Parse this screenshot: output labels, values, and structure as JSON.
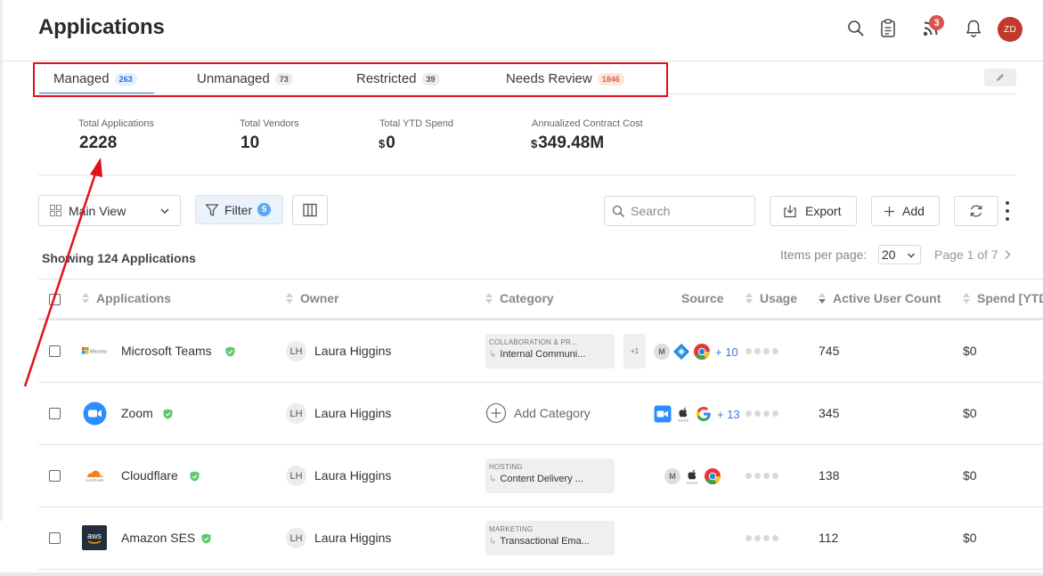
{
  "header": {
    "title": "Applications",
    "notifications_badge": "3",
    "avatar_initials": "ZD",
    "icons": [
      "search-icon",
      "clipboard-icon",
      "feed-icon",
      "bell-icon"
    ]
  },
  "tabs": [
    {
      "label": "Managed",
      "count": "263",
      "active": true
    },
    {
      "label": "Unmanaged",
      "count": "73"
    },
    {
      "label": "Restricted",
      "count": "39"
    },
    {
      "label": "Needs Review",
      "count": "1846"
    }
  ],
  "stats": [
    {
      "label": "Total Applications",
      "value": "2228",
      "currency": ""
    },
    {
      "label": "Total Vendors",
      "value": "10",
      "currency": ""
    },
    {
      "label": "Total YTD Spend",
      "value": "0",
      "currency": "$"
    },
    {
      "label": "Annualized Contract Cost",
      "value": "349.48M",
      "currency": "$"
    }
  ],
  "toolbar": {
    "view_label": "Main View",
    "filter_label": "Filter",
    "filter_count": "5",
    "search_placeholder": "Search",
    "export_label": "Export",
    "add_label": "Add"
  },
  "list_info": {
    "showing": "Showing 124 Applications",
    "items_per_page_label": "Items per page:",
    "items_per_page": "20",
    "page_info": "Page 1 of 7"
  },
  "columns": [
    "Applications",
    "Owner",
    "Category",
    "Source",
    "Usage",
    "Active User Count",
    "Spend [YTD]"
  ],
  "rows": [
    {
      "name": "Microsoft Teams",
      "logo": "microsoft-logo",
      "owner_initials": "LH",
      "owner": "Laura Higgins",
      "category_top": "COLLABORATION & PR...",
      "category_sub": "Internal Communi...",
      "category_more": "+1",
      "source_more": "+ 10",
      "active_users": "745",
      "spend": "$0"
    },
    {
      "name": "Zoom",
      "logo": "zoom-logo",
      "owner_initials": "LH",
      "owner": "Laura Higgins",
      "add_category": "Add Category",
      "source_more": "+ 13",
      "active_users": "345",
      "spend": "$0"
    },
    {
      "name": "Cloudflare",
      "logo": "cloudflare-logo",
      "owner_initials": "LH",
      "owner": "Laura Higgins",
      "category_top": "HOSTING",
      "category_sub": "Content Delivery ...",
      "active_users": "138",
      "spend": "$0"
    },
    {
      "name": "Amazon SES",
      "logo": "aws-logo",
      "owner_initials": "LH",
      "owner": "Laura Higgins",
      "category_top": "MARKETING",
      "category_sub": "Transactional Ema...",
      "active_users": "112",
      "spend": "$0"
    }
  ],
  "colors": {
    "accent": "#3f7ad6",
    "annotation": "#e0111b",
    "avatar": "#c0392b",
    "badge_orange": "#e0643f"
  }
}
